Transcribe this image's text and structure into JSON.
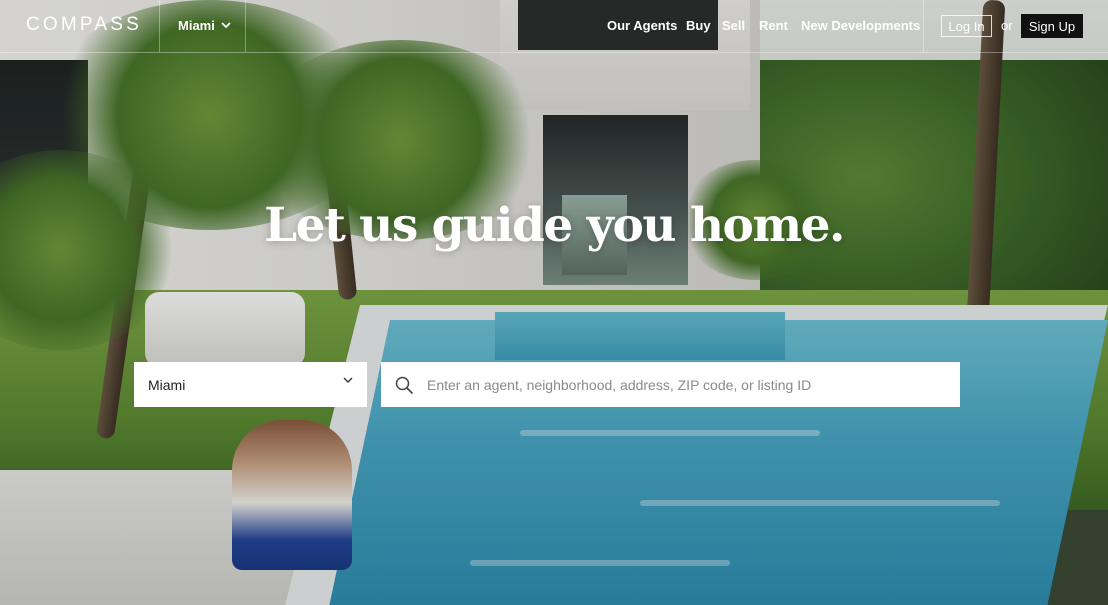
{
  "brand": {
    "logo_text": "COMPASS"
  },
  "header": {
    "city": "Miami",
    "nav": [
      "Our Agents",
      "Buy",
      "Sell",
      "Rent",
      "New Developments"
    ],
    "login_label": "Log In",
    "or_text": "or",
    "signup_label": "Sign Up"
  },
  "hero": {
    "headline": "Let us guide you home."
  },
  "search": {
    "city_value": "Miami",
    "placeholder": "Enter an agent, neighborhood, address, ZIP code, or listing ID"
  },
  "colors": {
    "signup_bg": "#111111",
    "input_bg": "#ffffff",
    "text_on_image": "#ffffff"
  }
}
